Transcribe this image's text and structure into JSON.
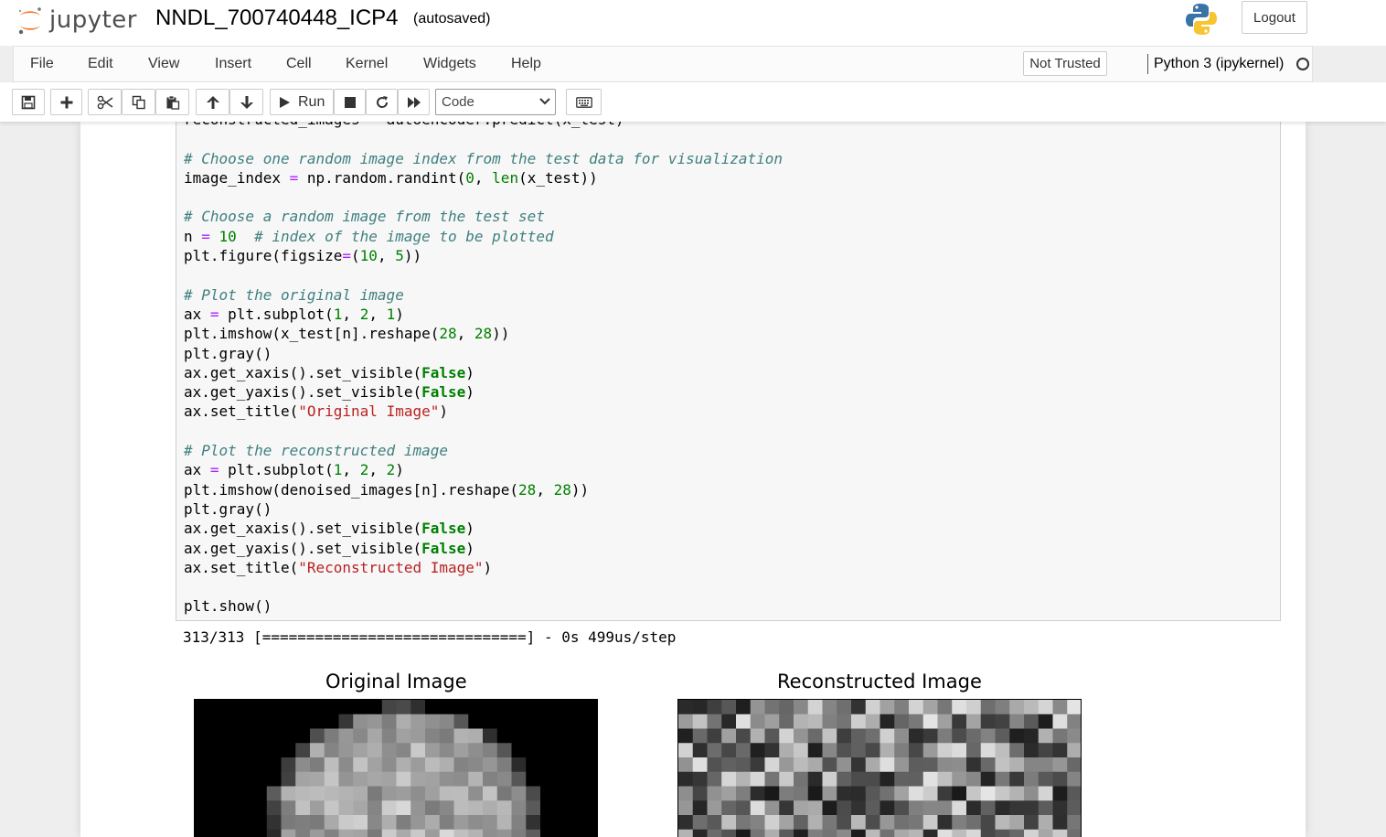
{
  "header": {
    "logo_text": "jupyter",
    "notebook_name": "NNDL_700740448_ICP4",
    "autosave_status": "(autosaved)",
    "logout_label": "Logout"
  },
  "menubar": {
    "items": [
      "File",
      "Edit",
      "View",
      "Insert",
      "Cell",
      "Kernel",
      "Widgets",
      "Help"
    ],
    "trust_label": "Not Trusted",
    "kernel_name": "Python 3 (ipykernel)"
  },
  "toolbar": {
    "run_label": "Run",
    "cell_type": "Code",
    "buttons": [
      "save-icon",
      "plus-icon",
      "cut-icon",
      "copy-icon",
      "paste-icon",
      "arrow-up-icon",
      "arrow-down-icon",
      "play-icon",
      "stop-icon",
      "restart-icon",
      "fast-forward-icon",
      "keyboard-icon"
    ]
  },
  "cell": {
    "code_lines": [
      "reconstructed_images = autoencoder.predict(x_test)",
      "",
      "# Choose one random image index from the test data for visualization",
      "image_index = np.random.randint(0, len(x_test))",
      "",
      "# Choose a random image from the test set",
      "n = 10  # index of the image to be plotted",
      "plt.figure(figsize=(10, 5))",
      "",
      "# Plot the original image",
      "ax = plt.subplot(1, 2, 1)",
      "plt.imshow(x_test[n].reshape(28, 28))",
      "plt.gray()",
      "ax.get_xaxis().set_visible(False)",
      "ax.get_yaxis().set_visible(False)",
      "ax.set_title(\"Original Image\")",
      "",
      "# Plot the reconstructed image",
      "ax = plt.subplot(1, 2, 2)",
      "plt.imshow(denoised_images[n].reshape(28, 28))",
      "plt.gray()",
      "ax.get_xaxis().set_visible(False)",
      "ax.get_yaxis().set_visible(False)",
      "ax.set_title(\"Reconstructed Image\")",
      "",
      "plt.show()"
    ],
    "output_text": "313/313 [==============================] - 0s 499us/step",
    "plot_titles": [
      "Original Image",
      "Reconstructed Image"
    ]
  }
}
